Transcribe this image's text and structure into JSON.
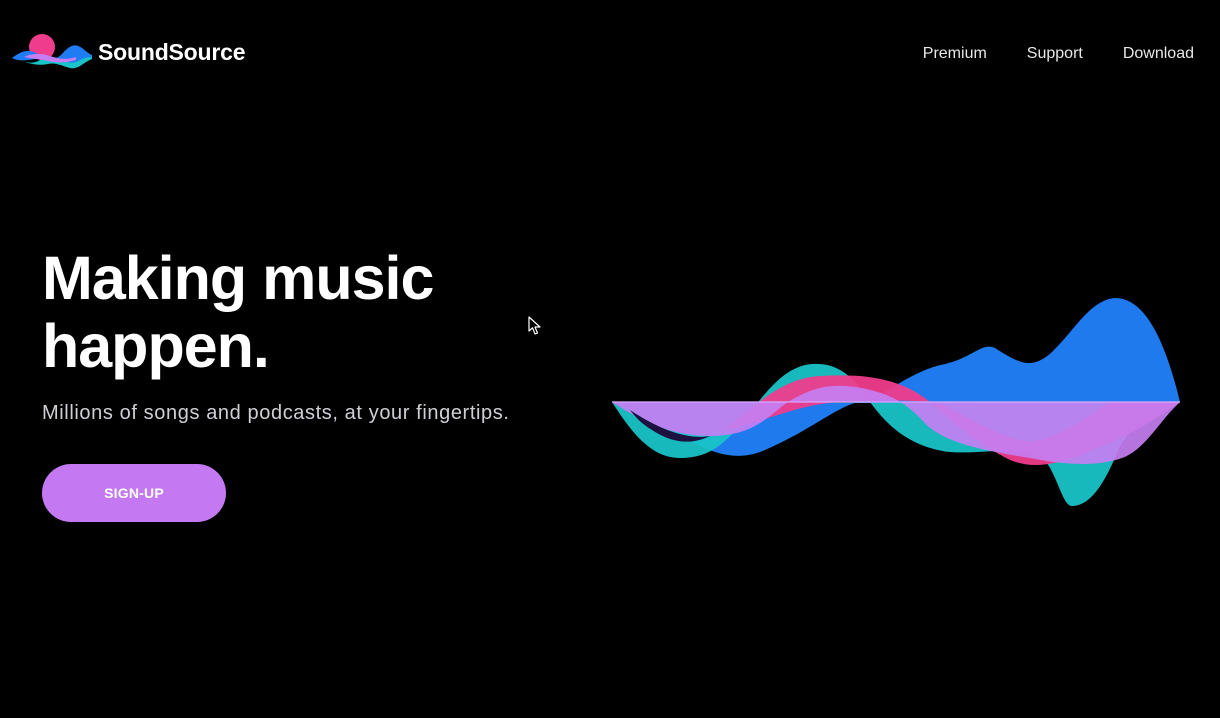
{
  "header": {
    "brand_name": "SoundSource",
    "logo_icon": "soundwave-logo-icon",
    "nav": [
      {
        "label": "Premium"
      },
      {
        "label": "Support"
      },
      {
        "label": "Download"
      }
    ]
  },
  "hero": {
    "headline_line1": "Making music",
    "headline_line2": "happen.",
    "subheadline": "Millions of songs and podcasts, at your fingertips.",
    "cta_label": "SIGN-UP",
    "illustration": "soundwave-illustration"
  },
  "colors": {
    "background": "#000000",
    "accent_purple": "#c479f2",
    "wave_blue": "#1f7cf2",
    "wave_teal": "#19c3c7",
    "wave_pink": "#ef3c8c",
    "wave_violet": "#c57ef2"
  }
}
